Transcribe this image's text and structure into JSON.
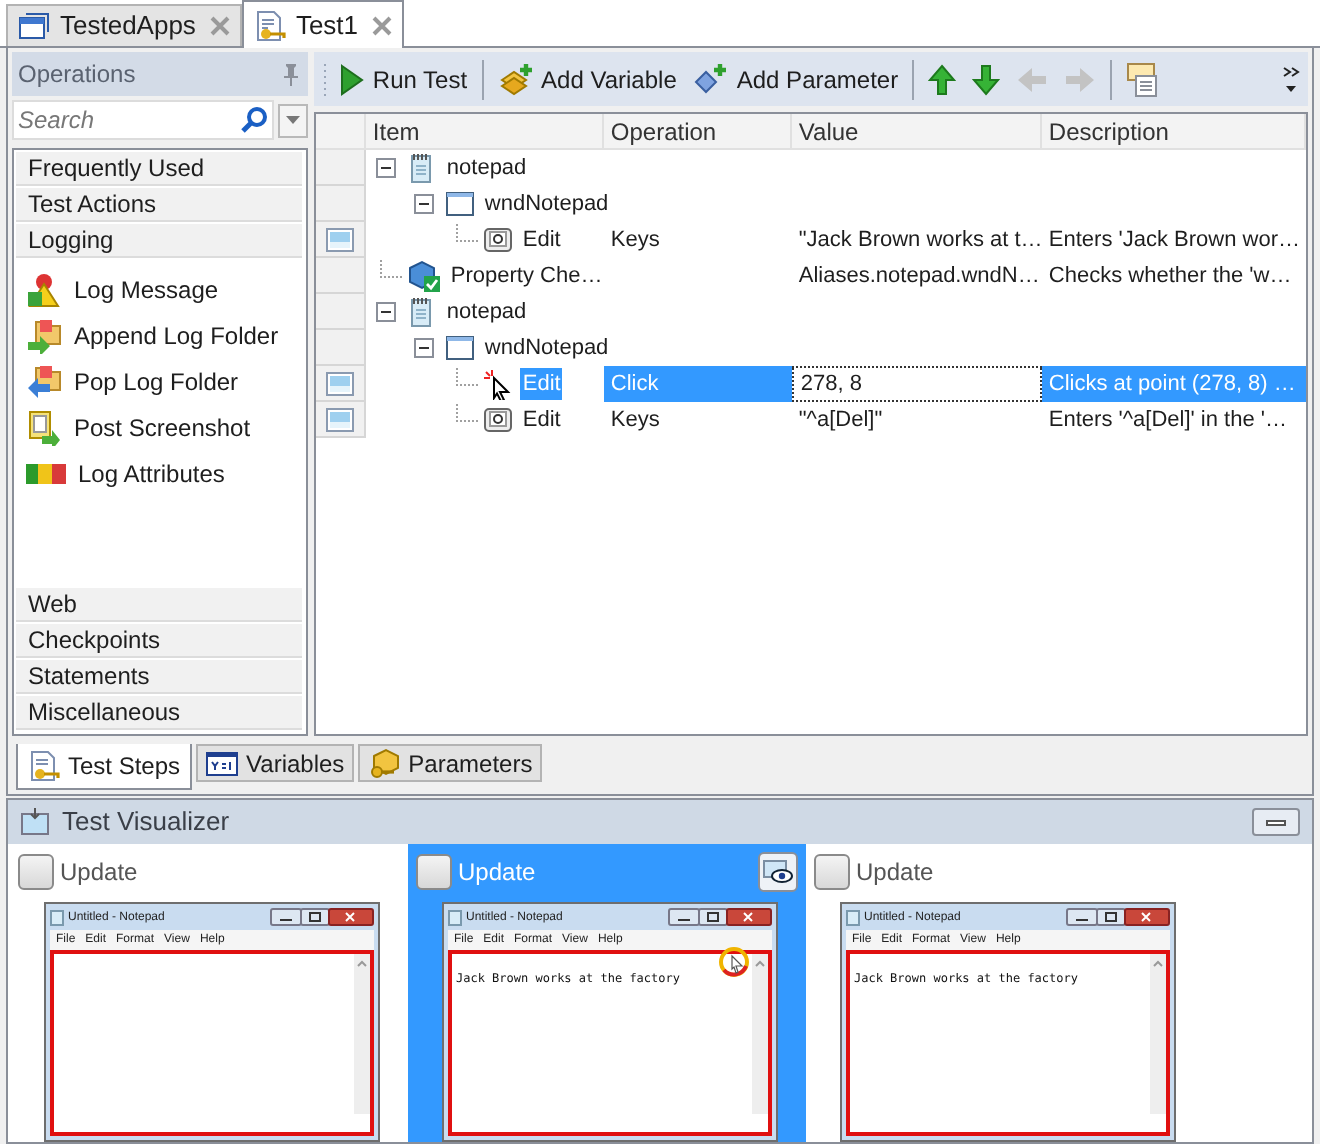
{
  "editor_tabs": [
    {
      "label": "TestedApps",
      "kind": "apps",
      "selected": false
    },
    {
      "label": "Test1",
      "kind": "test",
      "selected": true
    }
  ],
  "operations": {
    "title": "Operations",
    "search_placeholder": "Search",
    "categories": [
      {
        "label": "Frequently Used",
        "expanded": false
      },
      {
        "label": "Test Actions",
        "expanded": false
      },
      {
        "label": "Logging",
        "expanded": true,
        "items": [
          {
            "label": "Log Message",
            "kind": "message"
          },
          {
            "label": "Append Log Folder",
            "kind": "append"
          },
          {
            "label": "Pop Log Folder",
            "kind": "pop"
          },
          {
            "label": "Post Screenshot",
            "kind": "screenshot"
          },
          {
            "label": "Log Attributes",
            "kind": "attributes"
          }
        ]
      },
      {
        "label": "Web",
        "expanded": false
      },
      {
        "label": "Checkpoints",
        "expanded": false
      },
      {
        "label": "Statements",
        "expanded": false
      },
      {
        "label": "Miscellaneous",
        "expanded": false
      }
    ]
  },
  "toolbar": [
    {
      "kind": "run",
      "label": "Run Test",
      "disabled": false
    },
    {
      "kind": "separator"
    },
    {
      "kind": "add-variable",
      "label": "Add Variable",
      "disabled": false
    },
    {
      "kind": "add-parameter",
      "label": "Add Parameter",
      "disabled": false
    },
    {
      "kind": "separator"
    },
    {
      "kind": "up",
      "disabled": false
    },
    {
      "kind": "down",
      "disabled": false
    },
    {
      "kind": "left",
      "disabled": true
    },
    {
      "kind": "right",
      "disabled": true
    },
    {
      "kind": "separator"
    },
    {
      "kind": "comment",
      "disabled": false
    }
  ],
  "grid": {
    "columns": [
      "Item",
      "Operation",
      "Value",
      "Description"
    ],
    "rows": [
      {
        "item": "notepad",
        "kind": "process",
        "expanded": true,
        "selected": false,
        "has_screenshot": false,
        "children": [
          {
            "item": "wndNotepad",
            "kind": "window",
            "expanded": true,
            "selected": false,
            "has_screenshot": false,
            "children": [
              {
                "item": "Edit",
                "kind": "keys",
                "operation": "Keys",
                "value": "\"Jack Brown works at t…",
                "description": "Enters 'Jack Brown wor…",
                "selected": false,
                "has_screenshot": true
              }
            ]
          }
        ]
      },
      {
        "item": "Property Che…",
        "kind": "checkpoint",
        "value": "Aliases.notepad.wndN…",
        "description": "Checks whether the 'w…",
        "selected": false,
        "has_screenshot": false
      },
      {
        "item": "notepad",
        "kind": "process",
        "expanded": true,
        "selected": false,
        "has_screenshot": false,
        "children": [
          {
            "item": "wndNotepad",
            "kind": "window",
            "expanded": true,
            "selected": false,
            "has_screenshot": false,
            "children": [
              {
                "item": "Edit",
                "kind": "click",
                "operation": "Click",
                "value": "278, 8",
                "description": "Clicks at point (278, 8) …",
                "selected": true,
                "has_screenshot": true
              },
              {
                "item": "Edit",
                "kind": "keys",
                "operation": "Keys",
                "value": "\"^a[Del]\"",
                "description": "Enters '^a[Del]' in the '…",
                "selected": false,
                "has_screenshot": true
              }
            ]
          }
        ]
      }
    ]
  },
  "bottom_tabs": [
    {
      "label": "Test Steps",
      "kind": "steps",
      "selected": true
    },
    {
      "label": "Variables",
      "kind": "variables",
      "selected": false
    },
    {
      "label": "Parameters",
      "kind": "parameters",
      "selected": false
    }
  ],
  "visualizer": {
    "title": "Test Visualizer",
    "frames": [
      {
        "update_label": "Update",
        "checked": false,
        "selected": false,
        "click_marker": false,
        "window": {
          "title": "Untitled - Notepad",
          "menu": [
            "File",
            "Edit",
            "Format",
            "View",
            "Help"
          ]
        }
      },
      {
        "update_label": "Update",
        "checked": false,
        "selected": true,
        "click_marker": true,
        "window": {
          "title": "Untitled - Notepad",
          "menu": [
            "File",
            "Edit",
            "Format",
            "View",
            "Help"
          ],
          "text": "Jack Brown works at the factory"
        }
      },
      {
        "update_label": "Update",
        "checked": false,
        "selected": false,
        "click_marker": false,
        "window": {
          "title": "Untitled - Notepad",
          "menu": [
            "File",
            "Edit",
            "Format",
            "View",
            "Help"
          ],
          "text": "Jack Brown works at the factory"
        }
      }
    ]
  }
}
